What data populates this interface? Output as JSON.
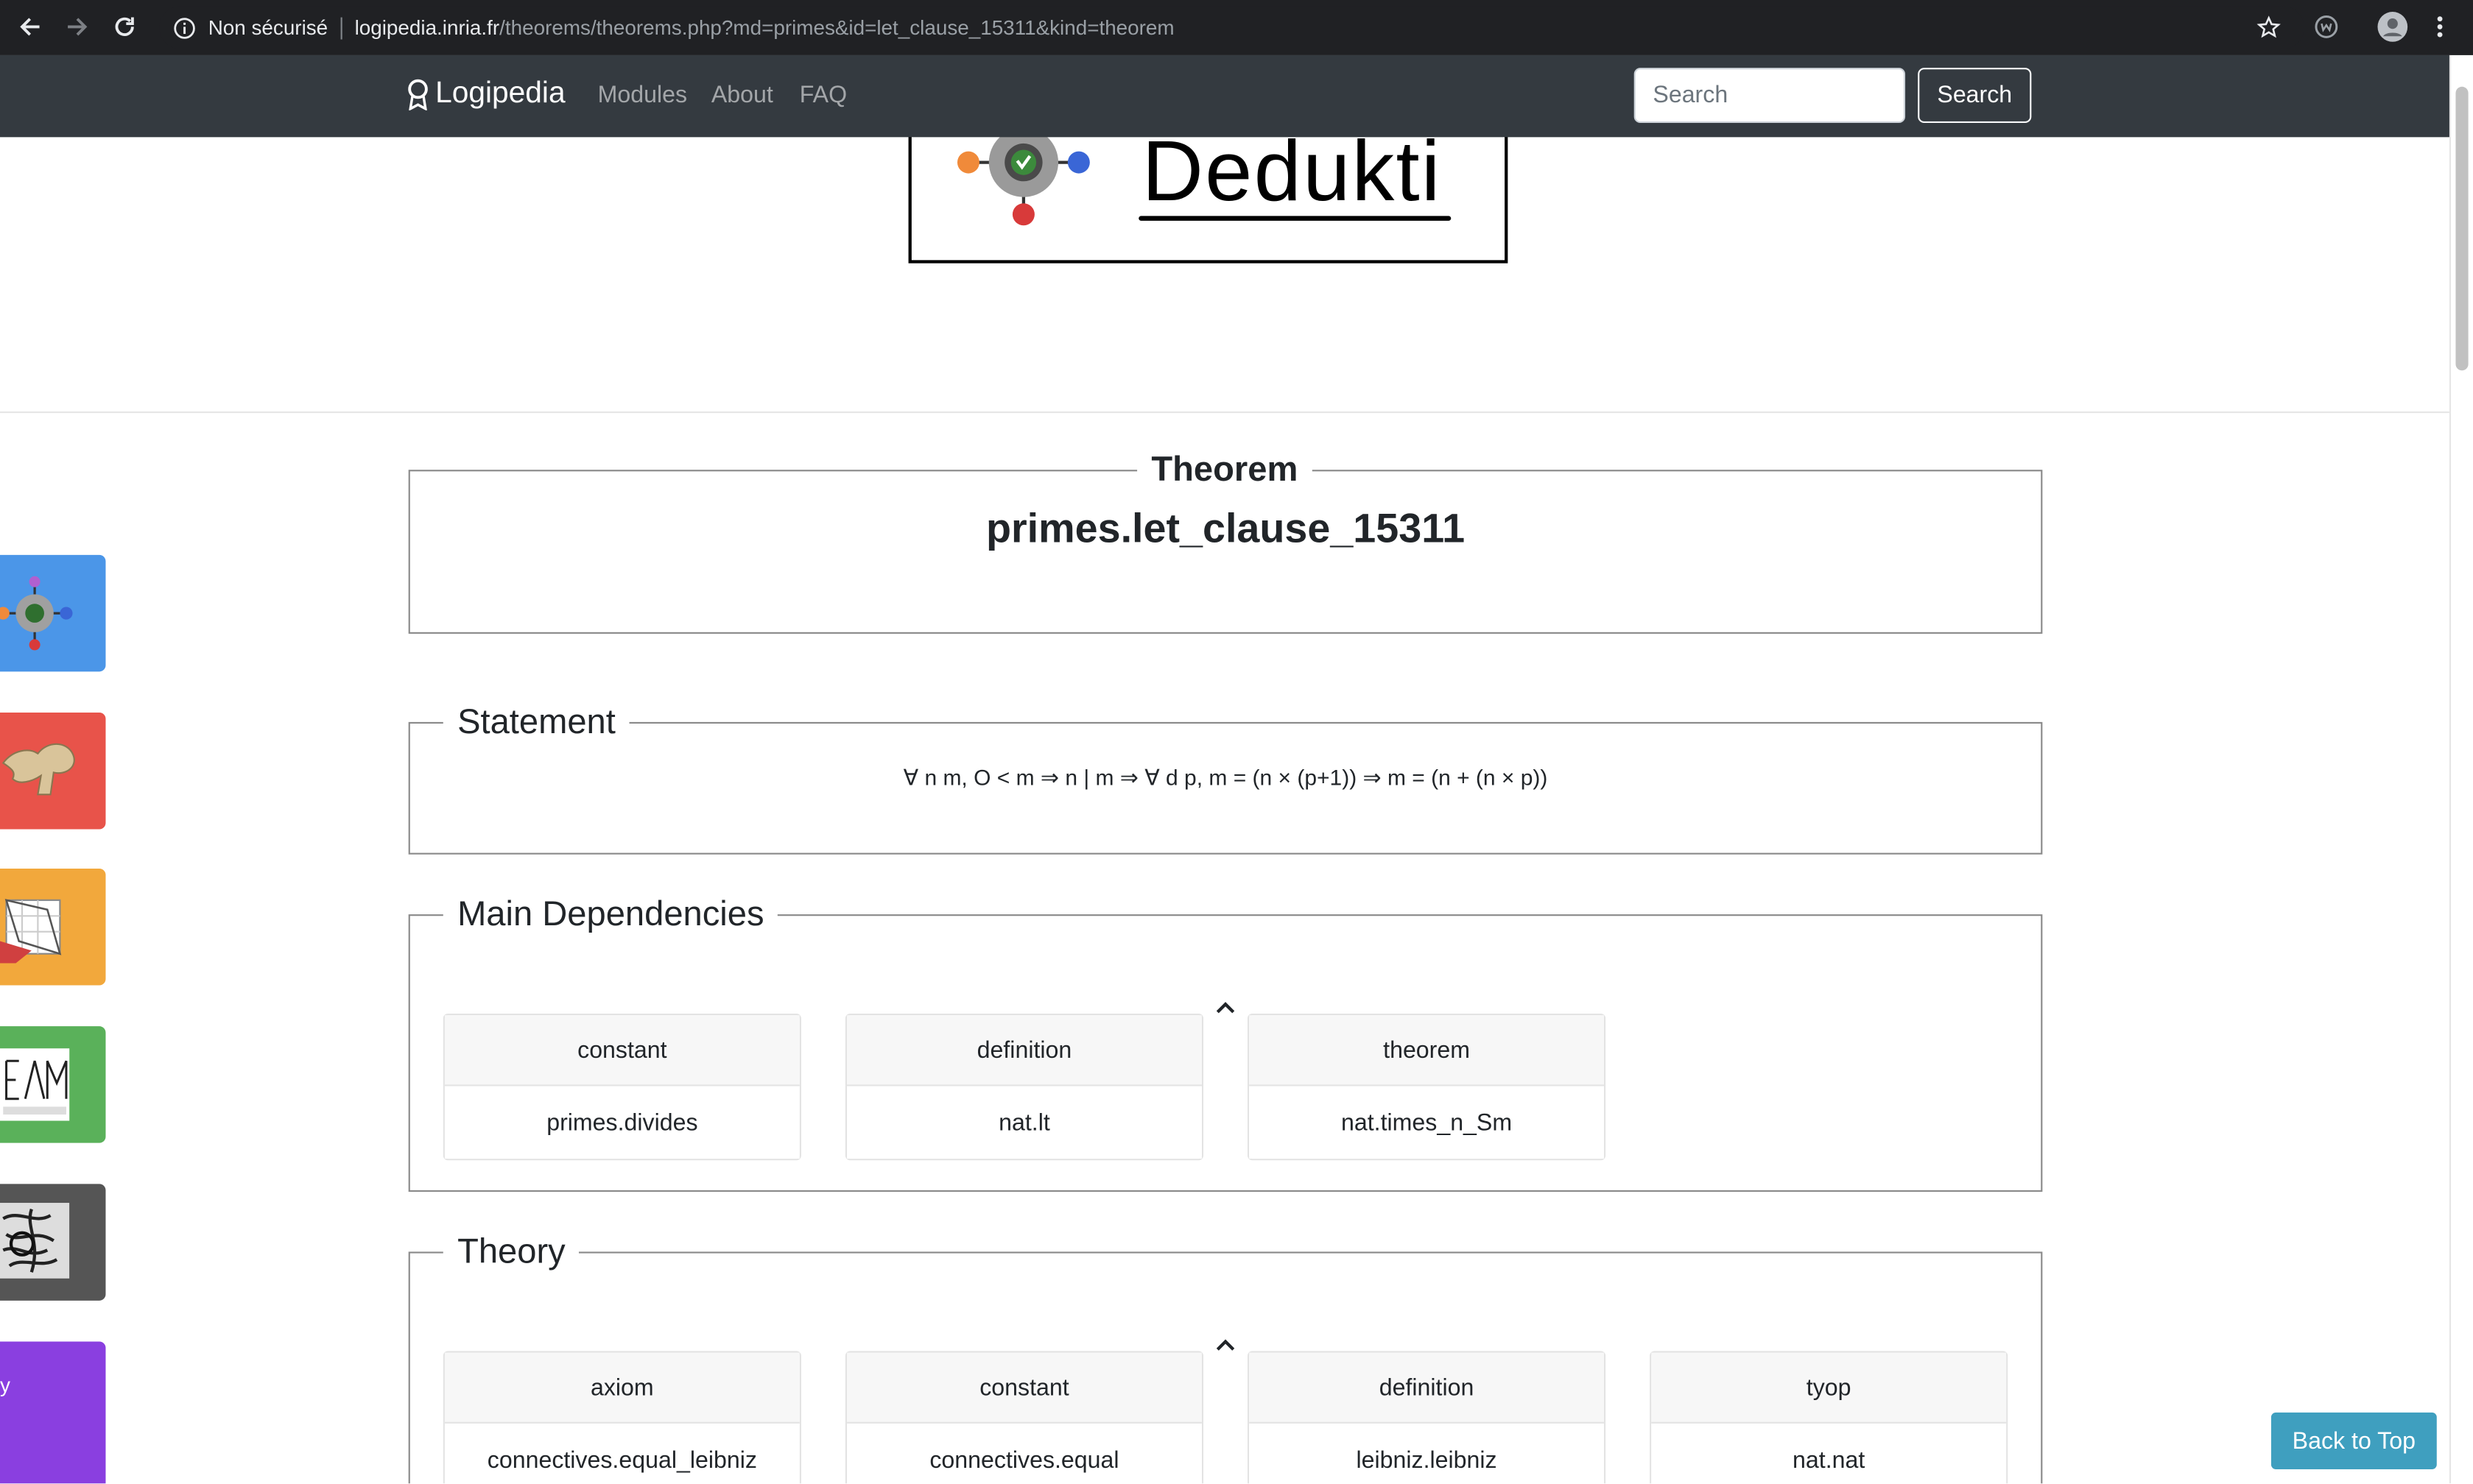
{
  "browser": {
    "security_label": "Non sécurisé",
    "url_host": "logipedia.inria.fr",
    "url_path": "/theorems/theorems.php?md=primes&id=let_clause_15311&kind=theorem"
  },
  "navbar": {
    "brand": "Logipedia",
    "links": [
      "Modules",
      "About",
      "FAQ"
    ],
    "search_placeholder": "Search",
    "search_button": "Search"
  },
  "logo": {
    "word": "Dedukti"
  },
  "side_tabs": [
    {
      "name": "dedukti",
      "color": "#4b96e8"
    },
    {
      "name": "red",
      "color": "#e8534a"
    },
    {
      "name": "orange",
      "color": "#f2a83c"
    },
    {
      "name": "green",
      "color": "#5ab15a"
    },
    {
      "name": "dark",
      "color": "#555555"
    },
    {
      "name": "purple",
      "color": "#8a3fe0",
      "label": "y"
    }
  ],
  "theorem": {
    "legend": "Theorem",
    "name": "primes.let_clause_15311"
  },
  "statement": {
    "legend": "Statement",
    "formula": "∀ n m, O < m ⇒ n | m ⇒ ∀ d p, m = (n × (p+1)) ⇒ m = (n + (n × p))"
  },
  "main_dependencies": {
    "legend": "Main Dependencies",
    "cards": [
      {
        "kind": "constant",
        "value": "primes.divides"
      },
      {
        "kind": "definition",
        "value": "nat.lt"
      },
      {
        "kind": "theorem",
        "value": "nat.times_n_Sm"
      }
    ]
  },
  "theory": {
    "legend": "Theory",
    "cards": [
      {
        "kind": "axiom",
        "value": "connectives.equal_leibniz"
      },
      {
        "kind": "constant",
        "value": "connectives.equal"
      },
      {
        "kind": "definition",
        "value": "leibniz.leibniz"
      },
      {
        "kind": "tyop",
        "value": "nat.nat"
      }
    ]
  },
  "back_to_top": "Back to Top",
  "colors": {
    "navbar": "#343a40",
    "chrome": "#202124",
    "back_to_top": "#3f9fbf"
  }
}
